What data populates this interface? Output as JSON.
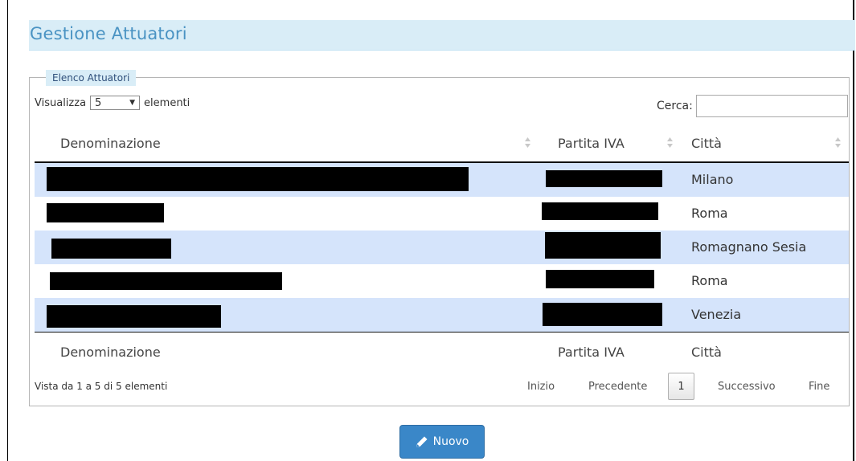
{
  "page_title": "Gestione Attuatori",
  "panel": {
    "legend": "Elenco Attuatori",
    "length_prefix": "Visualizza",
    "length_value": "5",
    "length_suffix": "elementi",
    "search_label": "Cerca:",
    "search_value": ""
  },
  "table": {
    "columns": [
      "Denominazione",
      "Partita IVA",
      "Città"
    ],
    "rows": [
      {
        "denominazione": "[redacted]",
        "partita_iva": "[redacted]",
        "citta": "Milano"
      },
      {
        "denominazione": "[redacted]",
        "partita_iva": "[redacted]",
        "citta": "Roma"
      },
      {
        "denominazione": "[redacted]",
        "partita_iva": "[redacted]",
        "citta": "Romagnano Sesia"
      },
      {
        "denominazione": "[redacted]",
        "partita_iva": "[redacted]",
        "citta": "Roma"
      },
      {
        "denominazione": "[redacted]",
        "partita_iva": "[redacted]",
        "citta": "Venezia"
      }
    ],
    "info": "Vista da 1 a 5 di 5 elementi"
  },
  "pagination": {
    "first": "Inizio",
    "previous": "Precedente",
    "current": "1",
    "next": "Successivo",
    "last": "Fine"
  },
  "actions": {
    "new_label": "Nuovo"
  },
  "icons": {
    "sort": "sort-both-icon",
    "select": "chevron-down-icon",
    "new": "pencil-icon"
  },
  "colors": {
    "title": "#4a93c3",
    "title_bg": "#d9edf7",
    "odd_row": "#d5e4fb",
    "primary_button": "#3a87c8"
  }
}
